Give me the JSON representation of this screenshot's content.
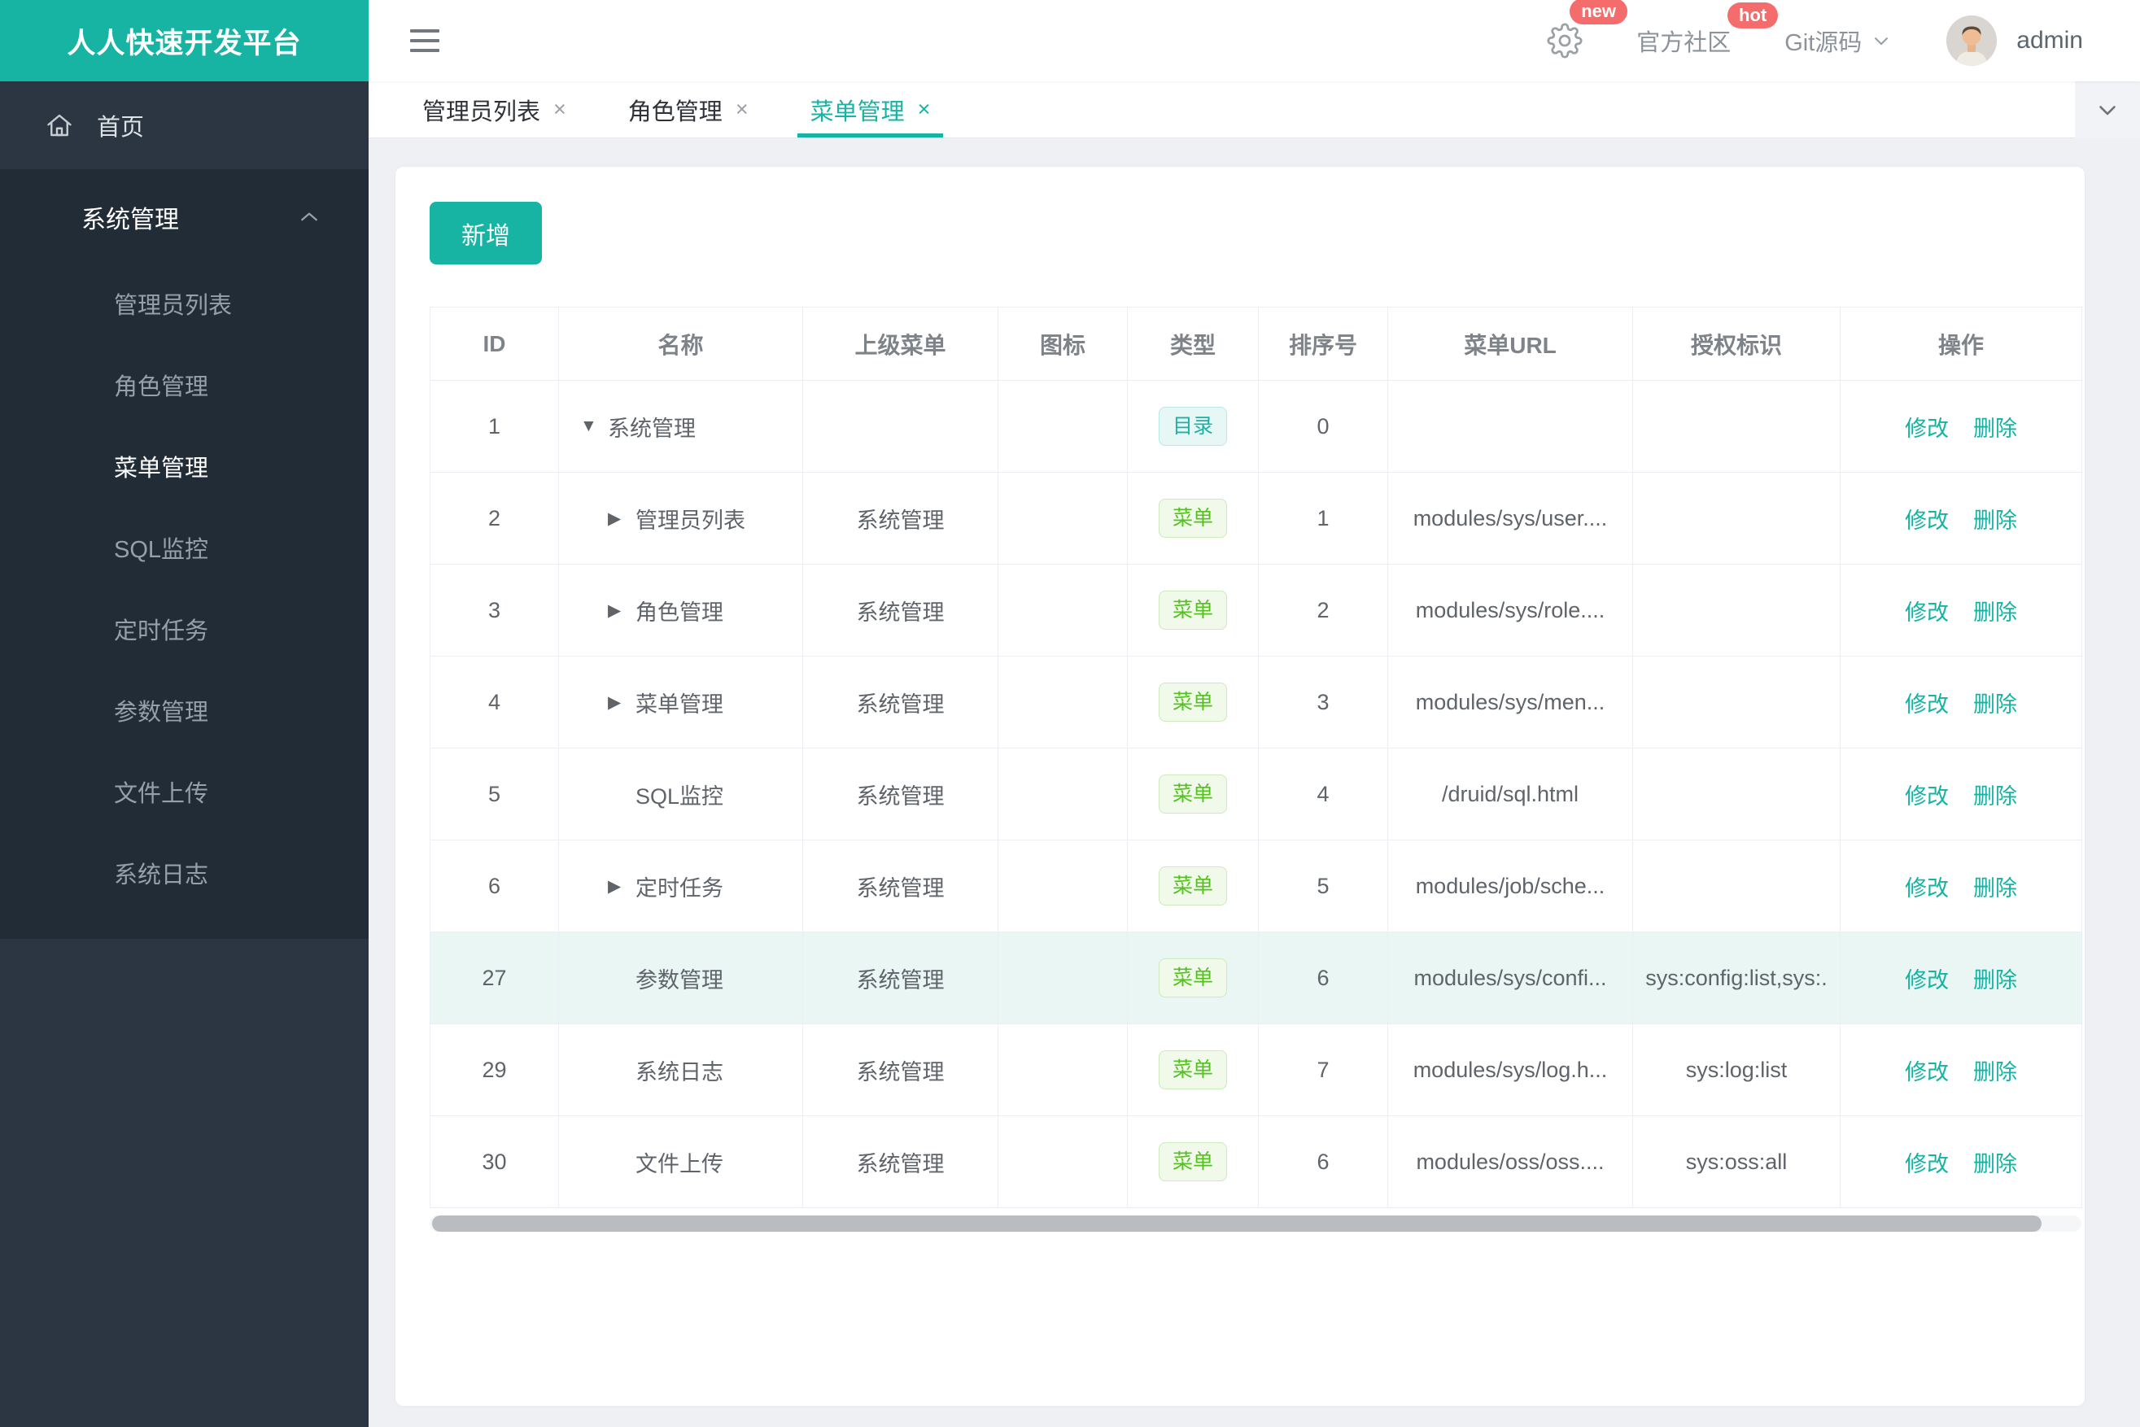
{
  "app": {
    "logo_text": "人人快速开发平台",
    "accent_color": "#17b3a3"
  },
  "header": {
    "settings_badge": "new",
    "community_label": "官方社区",
    "community_badge": "hot",
    "git_label": "Git源码",
    "user_name": "admin"
  },
  "tabs": {
    "close_glyph": "×",
    "items": [
      {
        "key": "admin-list",
        "label": "管理员列表",
        "active": false
      },
      {
        "key": "role-mgmt",
        "label": "角色管理",
        "active": false
      },
      {
        "key": "menu-mgmt",
        "label": "菜单管理",
        "active": true
      }
    ]
  },
  "sidebar": {
    "home_label": "首页",
    "group_label": "系统管理",
    "items": [
      {
        "key": "admin-list",
        "label": "管理员列表",
        "active": false
      },
      {
        "key": "role-mgmt",
        "label": "角色管理",
        "active": false
      },
      {
        "key": "menu-mgmt",
        "label": "菜单管理",
        "active": true
      },
      {
        "key": "sql-monitor",
        "label": "SQL监控",
        "active": false
      },
      {
        "key": "scheduled-tasks",
        "label": "定时任务",
        "active": false
      },
      {
        "key": "param-mgmt",
        "label": "参数管理",
        "active": false
      },
      {
        "key": "file-upload",
        "label": "文件上传",
        "active": false
      },
      {
        "key": "system-log",
        "label": "系统日志",
        "active": false
      }
    ]
  },
  "toolbar": {
    "add_label": "新增"
  },
  "table": {
    "columns": [
      "ID",
      "名称",
      "上级菜单",
      "图标",
      "类型",
      "排序号",
      "菜单URL",
      "授权标识",
      "操作"
    ],
    "edit_label": "修改",
    "delete_label": "删除",
    "badge_colors": {
      "dir": {
        "text": "#1db0a8",
        "bg": "#e7f7f6",
        "border": "#b9e7e4"
      },
      "menu": {
        "text": "#53c21d",
        "bg": "#f0f9ea",
        "border": "#cdeabc"
      }
    },
    "highlight_color": "#e9f6f3",
    "rows": [
      {
        "id": "1",
        "caret": "down",
        "child": false,
        "name": "系统管理",
        "parent": "",
        "icon": "",
        "type": "目录",
        "type_style": "dir",
        "order": "0",
        "url": "",
        "perm": "",
        "highlight": false
      },
      {
        "id": "2",
        "caret": "right",
        "child": true,
        "name": "管理员列表",
        "parent": "系统管理",
        "icon": "",
        "type": "菜单",
        "type_style": "menu",
        "order": "1",
        "url": "modules/sys/user....",
        "perm": "",
        "highlight": false
      },
      {
        "id": "3",
        "caret": "right",
        "child": true,
        "name": "角色管理",
        "parent": "系统管理",
        "icon": "",
        "type": "菜单",
        "type_style": "menu",
        "order": "2",
        "url": "modules/sys/role....",
        "perm": "",
        "highlight": false
      },
      {
        "id": "4",
        "caret": "right",
        "child": true,
        "name": "菜单管理",
        "parent": "系统管理",
        "icon": "",
        "type": "菜单",
        "type_style": "menu",
        "order": "3",
        "url": "modules/sys/men...",
        "perm": "",
        "highlight": false
      },
      {
        "id": "5",
        "caret": "none",
        "child": true,
        "name": "SQL监控",
        "parent": "系统管理",
        "icon": "",
        "type": "菜单",
        "type_style": "menu",
        "order": "4",
        "url": "/druid/sql.html",
        "perm": "",
        "highlight": false
      },
      {
        "id": "6",
        "caret": "right",
        "child": true,
        "name": "定时任务",
        "parent": "系统管理",
        "icon": "",
        "type": "菜单",
        "type_style": "menu",
        "order": "5",
        "url": "modules/job/sche...",
        "perm": "",
        "highlight": false
      },
      {
        "id": "27",
        "caret": "none",
        "child": true,
        "name": "参数管理",
        "parent": "系统管理",
        "icon": "",
        "type": "菜单",
        "type_style": "menu",
        "order": "6",
        "url": "modules/sys/confi...",
        "perm": "sys:config:list,sys:.",
        "highlight": true
      },
      {
        "id": "29",
        "caret": "none",
        "child": true,
        "name": "系统日志",
        "parent": "系统管理",
        "icon": "",
        "type": "菜单",
        "type_style": "menu",
        "order": "7",
        "url": "modules/sys/log.h...",
        "perm": "sys:log:list",
        "highlight": false
      },
      {
        "id": "30",
        "caret": "none",
        "child": true,
        "name": "文件上传",
        "parent": "系统管理",
        "icon": "",
        "type": "菜单",
        "type_style": "menu",
        "order": "6",
        "url": "modules/oss/oss....",
        "perm": "sys:oss:all",
        "highlight": false
      }
    ]
  }
}
